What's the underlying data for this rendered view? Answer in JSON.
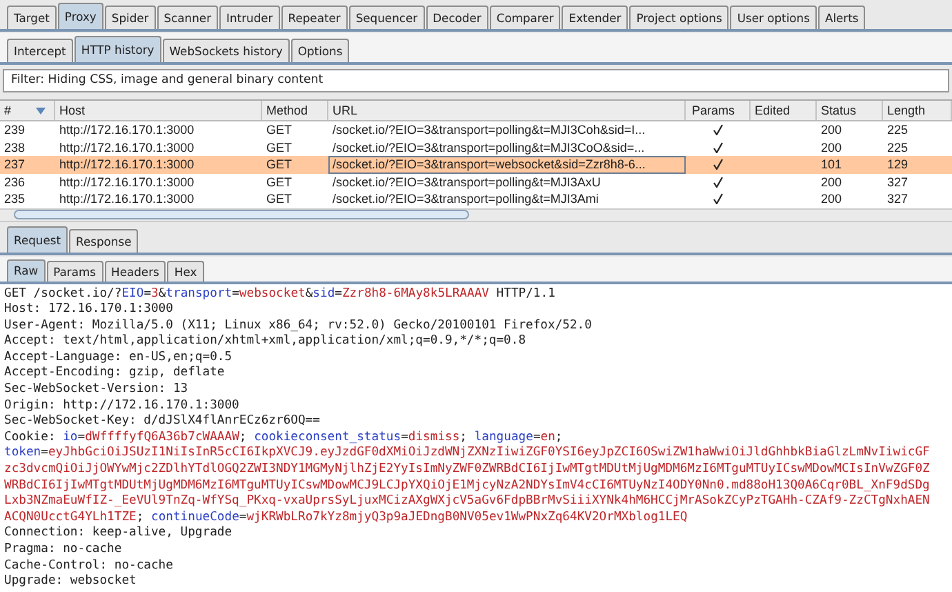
{
  "main_tabs": [
    {
      "label": "Target",
      "selected": false
    },
    {
      "label": "Proxy",
      "selected": true
    },
    {
      "label": "Spider",
      "selected": false
    },
    {
      "label": "Scanner",
      "selected": false
    },
    {
      "label": "Intruder",
      "selected": false
    },
    {
      "label": "Repeater",
      "selected": false
    },
    {
      "label": "Sequencer",
      "selected": false
    },
    {
      "label": "Decoder",
      "selected": false
    },
    {
      "label": "Comparer",
      "selected": false
    },
    {
      "label": "Extender",
      "selected": false
    },
    {
      "label": "Project options",
      "selected": false
    },
    {
      "label": "User options",
      "selected": false
    },
    {
      "label": "Alerts",
      "selected": false
    }
  ],
  "proxy_tabs": [
    {
      "label": "Intercept",
      "selected": false
    },
    {
      "label": "HTTP history",
      "selected": true
    },
    {
      "label": "WebSockets history",
      "selected": false
    },
    {
      "label": "Options",
      "selected": false
    }
  ],
  "filter": "Filter: Hiding CSS, image and general binary content",
  "table": {
    "columns": [
      "#",
      "Host",
      "Method",
      "URL",
      "Params",
      "Edited",
      "Status",
      "Length"
    ],
    "rows": [
      {
        "num": "239",
        "host": "http://172.16.170.1:3000",
        "method": "GET",
        "url": "/socket.io/?EIO=3&transport=polling&t=MJI3Coh&sid=I...",
        "params": true,
        "status": "200",
        "length": "225",
        "selected": false
      },
      {
        "num": "238",
        "host": "http://172.16.170.1:3000",
        "method": "GET",
        "url": "/socket.io/?EIO=3&transport=polling&t=MJI3CoO&sid=...",
        "params": true,
        "status": "200",
        "length": "225",
        "selected": false
      },
      {
        "num": "237",
        "host": "http://172.16.170.1:3000",
        "method": "GET",
        "url": "/socket.io/?EIO=3&transport=websocket&sid=Zzr8h8-6...",
        "params": true,
        "status": "101",
        "length": "129",
        "selected": true
      },
      {
        "num": "236",
        "host": "http://172.16.170.1:3000",
        "method": "GET",
        "url": "/socket.io/?EIO=3&transport=polling&t=MJI3AxU",
        "params": true,
        "status": "200",
        "length": "327",
        "selected": false
      },
      {
        "num": "235",
        "host": "http://172.16.170.1:3000",
        "method": "GET",
        "url": "/socket.io/?EIO=3&transport=polling&t=MJI3Ami",
        "params": true,
        "status": "200",
        "length": "327",
        "selected": false
      }
    ]
  },
  "message_tabs": [
    {
      "label": "Request",
      "selected": true
    },
    {
      "label": "Response",
      "selected": false
    }
  ],
  "view_tabs": [
    {
      "label": "Raw",
      "selected": true
    },
    {
      "label": "Params",
      "selected": false
    },
    {
      "label": "Headers",
      "selected": false
    },
    {
      "label": "Hex",
      "selected": false
    }
  ],
  "request_lines": [
    [
      {
        "t": "GET /socket.io/?",
        "kind": "plain"
      },
      {
        "t": "EIO",
        "kind": "name"
      },
      {
        "t": "=",
        "kind": "plain"
      },
      {
        "t": "3",
        "kind": "value"
      },
      {
        "t": "&",
        "kind": "plain"
      },
      {
        "t": "transport",
        "kind": "name"
      },
      {
        "t": "=",
        "kind": "plain"
      },
      {
        "t": "websocket",
        "kind": "value"
      },
      {
        "t": "&",
        "kind": "plain"
      },
      {
        "t": "sid",
        "kind": "name"
      },
      {
        "t": "=",
        "kind": "plain"
      },
      {
        "t": "Zzr8h8-6MAy8k5LRAAAV",
        "kind": "value"
      },
      {
        "t": " HTTP/1.1",
        "kind": "plain"
      }
    ],
    [
      {
        "t": "Host: 172.16.170.1:3000",
        "kind": "plain"
      }
    ],
    [
      {
        "t": "User-Agent: Mozilla/5.0 (X11; Linux x86_64; rv:52.0) Gecko/20100101 Firefox/52.0",
        "kind": "plain"
      }
    ],
    [
      {
        "t": "Accept: text/html,application/xhtml+xml,application/xml;q=0.9,*/*;q=0.8",
        "kind": "plain"
      }
    ],
    [
      {
        "t": "Accept-Language: en-US,en;q=0.5",
        "kind": "plain"
      }
    ],
    [
      {
        "t": "Accept-Encoding: gzip, deflate",
        "kind": "plain"
      }
    ],
    [
      {
        "t": "Sec-WebSocket-Version: 13",
        "kind": "plain"
      }
    ],
    [
      {
        "t": "Origin: http://172.16.170.1:3000",
        "kind": "plain"
      }
    ],
    [
      {
        "t": "Sec-WebSocket-Key: d/dJSlX4flAnrECz6zr6OQ==",
        "kind": "plain"
      }
    ],
    [
      {
        "t": "Cookie: ",
        "kind": "plain"
      },
      {
        "t": "io",
        "kind": "name"
      },
      {
        "t": "=",
        "kind": "plain"
      },
      {
        "t": "dWffffyfQ6A36b7cWAAAW",
        "kind": "value"
      },
      {
        "t": "; ",
        "kind": "plain"
      },
      {
        "t": "cookieconsent_status",
        "kind": "name"
      },
      {
        "t": "=",
        "kind": "plain"
      },
      {
        "t": "dismiss",
        "kind": "value"
      },
      {
        "t": "; ",
        "kind": "plain"
      },
      {
        "t": "language",
        "kind": "name"
      },
      {
        "t": "=",
        "kind": "plain"
      },
      {
        "t": "en",
        "kind": "value"
      },
      {
        "t": ";",
        "kind": "plain"
      }
    ],
    [
      {
        "t": "token",
        "kind": "name"
      },
      {
        "t": "=",
        "kind": "plain"
      },
      {
        "t": "eyJhbGciOiJSUzI1NiIsInR5cCI6IkpXVCJ9.eyJzdGF0dXMiOiJzdWNjZXNzIiwiZGF0YSI6eyJpZCI6OSwiZW1haWwiOiJldGhhbkBiaGlzLmNvIiwicGF",
        "kind": "value"
      }
    ],
    [
      {
        "t": "zc3dvcmQiOiJjOWYwMjc2ZDlhYTdlOGQ2ZWI3NDY1MGMyNjlhZjE2YyIsImNyZWF0ZWRBdCI6IjIwMTgtMDUtMjUgMDM6MzI6MTguMTUyICswMDowMCIsInVwZGF0Z",
        "kind": "value"
      }
    ],
    [
      {
        "t": "WRBdCI6IjIwMTgtMDUtMjUgMDM6MzI6MTguMTUyICswMDowMCJ9LCJpYXQiOjE1MjcyNzA2NDYsImV4cCI6MTUyNzI4ODY0Nn0.md88oH13Q0A6Cqr0BL_XnF9dSDg",
        "kind": "value"
      }
    ],
    [
      {
        "t": "Lxb3NZmaEuWfIZ-_EeVUl9TnZq-WfYSq_PKxq-vxaUprsSyLjuxMCizAXgWXjcV5aGv6FdpBBrMvSiiiXYNk4hM6HCCjMrASokZCyPzTGAHh-CZAf9-ZzCTgNxhAEN",
        "kind": "value"
      }
    ],
    [
      {
        "t": "ACQN0UcctG4YLh1TZE",
        "kind": "value"
      },
      {
        "t": "; ",
        "kind": "plain"
      },
      {
        "t": "continueCode",
        "kind": "name"
      },
      {
        "t": "=",
        "kind": "plain"
      },
      {
        "t": "wjKRWbLRo7kYz8mjyQ3p9aJEDngB0NV05ev1WwPNxZq64KV2OrMXblog1LEQ",
        "kind": "value"
      }
    ],
    [
      {
        "t": "Connection: keep-alive, Upgrade",
        "kind": "plain"
      }
    ],
    [
      {
        "t": "Pragma: no-cache",
        "kind": "plain"
      }
    ],
    [
      {
        "t": "Cache-Control: no-cache",
        "kind": "plain"
      }
    ],
    [
      {
        "t": "Upgrade: websocket",
        "kind": "plain"
      }
    ]
  ]
}
